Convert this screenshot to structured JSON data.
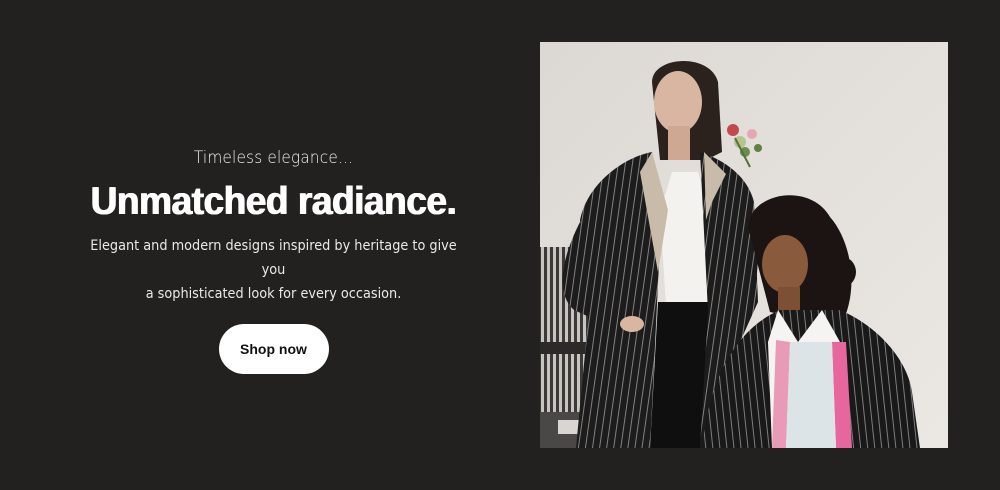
{
  "hero": {
    "eyebrow": "Timeless elegance...",
    "headline": "Unmatched radiance.",
    "description_line1": "Elegant and modern designs inspired by heritage to give you",
    "description_line2": "a sophisticated look for every occasion.",
    "cta_label": "Shop now"
  },
  "colors": {
    "background": "#232120",
    "cta_background": "#ffffff",
    "cta_text": "#111111"
  },
  "image": {
    "subject": "two-models-pinstripe-blazers"
  }
}
